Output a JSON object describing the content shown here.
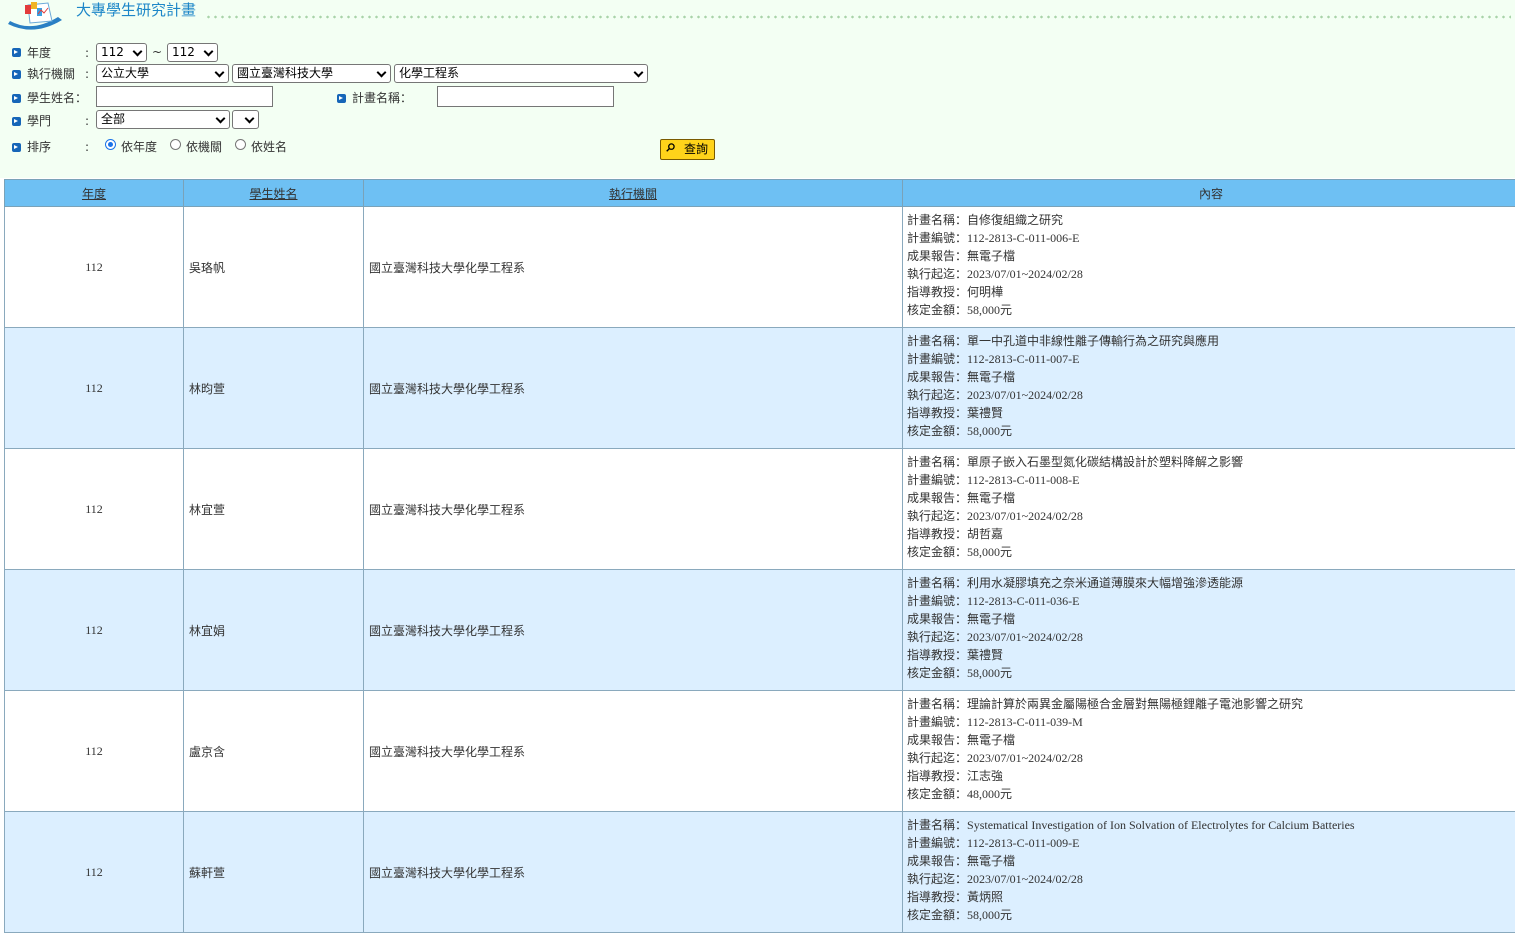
{
  "app": {
    "title": "大專學生研究計畫"
  },
  "filters": {
    "year": {
      "label": "年度",
      "from": "112",
      "sep": "~",
      "to": "112"
    },
    "institution": {
      "label": "執行機關",
      "type": "公立大學",
      "school": "國立臺灣科技大學",
      "department": "化學工程系"
    },
    "student": {
      "label": "學生姓名",
      "value": ""
    },
    "project": {
      "label": "計畫名稱",
      "value": ""
    },
    "field": {
      "label": "學門",
      "value": "全部",
      "sub": ""
    },
    "sort": {
      "label": "排序",
      "options": [
        "依年度",
        "依機關",
        "依姓名"
      ],
      "selected": "依年度"
    },
    "query_button": "查詢"
  },
  "table": {
    "headers": [
      "年度",
      "學生姓名",
      "執行機關",
      "內容"
    ],
    "field_labels": {
      "title": "計畫名稱：",
      "number": "計畫編號：",
      "report": "成果報告：",
      "period": "執行起迄：",
      "advisor": "指導教授：",
      "amount": "核定金額："
    },
    "rows": [
      {
        "year": "112",
        "student": "吳珞帆",
        "institution": "國立臺灣科技大學化學工程系",
        "title": "自修復組織之研究",
        "number": "112-2813-C-011-006-E",
        "report": "無電子檔",
        "period": "2023/07/01~2024/02/28",
        "advisor": "何明樺",
        "amount": "58,000元"
      },
      {
        "year": "112",
        "student": "林昀萱",
        "institution": "國立臺灣科技大學化學工程系",
        "title": "單一中孔道中非線性離子傳輸行為之研究與應用",
        "number": "112-2813-C-011-007-E",
        "report": "無電子檔",
        "period": "2023/07/01~2024/02/28",
        "advisor": "葉禮賢",
        "amount": "58,000元"
      },
      {
        "year": "112",
        "student": "林宜萱",
        "institution": "國立臺灣科技大學化學工程系",
        "title": "單原子嵌入石墨型氮化碳結構設計於塑料降解之影響",
        "number": "112-2813-C-011-008-E",
        "report": "無電子檔",
        "period": "2023/07/01~2024/02/28",
        "advisor": "胡哲嘉",
        "amount": "58,000元"
      },
      {
        "year": "112",
        "student": "林宜娟",
        "institution": "國立臺灣科技大學化學工程系",
        "title": "利用水凝膠填充之奈米通道薄膜來大幅增強滲透能源",
        "number": "112-2813-C-011-036-E",
        "report": "無電子檔",
        "period": "2023/07/01~2024/02/28",
        "advisor": "葉禮賢",
        "amount": "58,000元"
      },
      {
        "year": "112",
        "student": "盧京含",
        "institution": "國立臺灣科技大學化學工程系",
        "title": "理論計算於兩異金屬陽極合金層對無陽極鋰離子電池影響之研究",
        "number": "112-2813-C-011-039-M",
        "report": "無電子檔",
        "period": "2023/07/01~2024/02/28",
        "advisor": "江志強",
        "amount": "48,000元"
      },
      {
        "year": "112",
        "student": "蘇軒萱",
        "institution": "國立臺灣科技大學化學工程系",
        "title": "Systematical Investigation of Ion Solvation of Electrolytes for Calcium Batteries",
        "number": "112-2813-C-011-009-E",
        "report": "無電子檔",
        "period": "2023/07/01~2024/02/28",
        "advisor": "黃炳照",
        "amount": "58,000元"
      }
    ]
  }
}
